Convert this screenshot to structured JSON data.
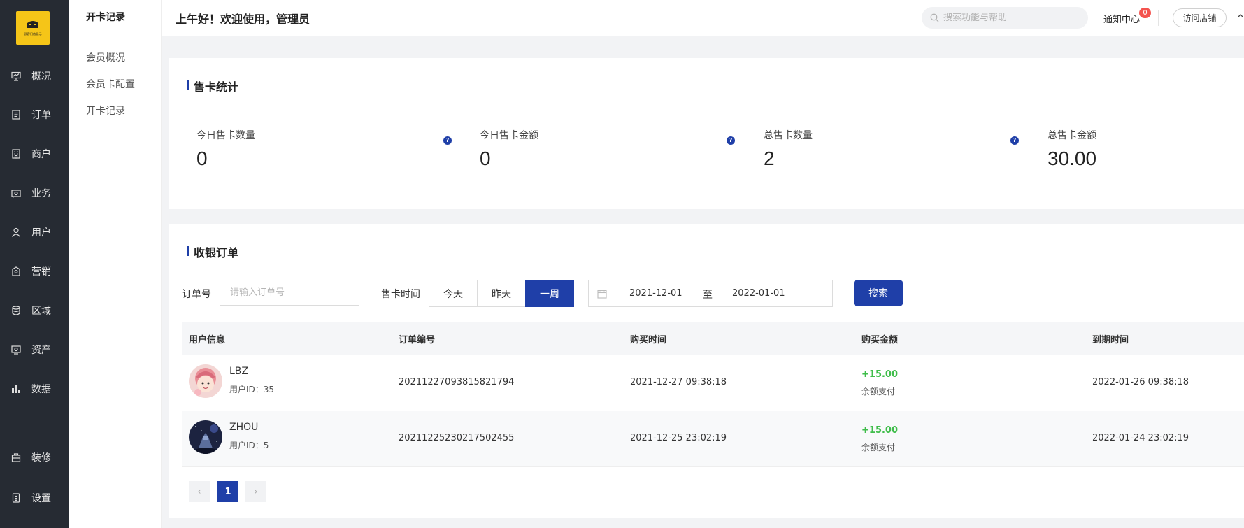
{
  "sidebar": {
    "logo_text": "顾客门店展示",
    "items": [
      {
        "label": "概况",
        "icon": "chart-icon"
      },
      {
        "label": "订单",
        "icon": "document-icon"
      },
      {
        "label": "商户",
        "icon": "building-icon"
      },
      {
        "label": "业务",
        "icon": "briefcase-icon"
      },
      {
        "label": "用户",
        "icon": "user-icon"
      },
      {
        "label": "营销",
        "icon": "marketing-icon"
      },
      {
        "label": "区域",
        "icon": "database-icon"
      },
      {
        "label": "资产",
        "icon": "asset-icon"
      },
      {
        "label": "数据",
        "icon": "bar-chart-icon"
      },
      {
        "label": "装修",
        "icon": "decoration-icon"
      },
      {
        "label": "设置",
        "icon": "settings-icon"
      }
    ]
  },
  "subnav": {
    "title": "开卡记录",
    "items": [
      "会员概况",
      "会员卡配置",
      "开卡记录"
    ]
  },
  "header": {
    "greeting": "上午好！欢迎使用，管理员",
    "search_placeholder": "搜索功能与帮助",
    "notice_label": "通知中心",
    "notice_count": "0",
    "visit_label": "访问店铺"
  },
  "stats": {
    "title": "售卡统计",
    "items": [
      {
        "label": "今日售卡数量",
        "value": "0"
      },
      {
        "label": "今日售卡金额",
        "value": "0"
      },
      {
        "label": "总售卡数量",
        "value": "2"
      },
      {
        "label": "总售卡金额",
        "value": "30.00"
      }
    ],
    "help_glyph": "?"
  },
  "orders": {
    "title": "收银订单",
    "filter": {
      "order_label": "订单号",
      "order_placeholder": "请输入订单号",
      "time_label": "售卡时间",
      "segments": [
        "今天",
        "昨天",
        "一周"
      ],
      "active_segment": "一周",
      "date_start": "2021-12-01",
      "date_sep": "至",
      "date_end": "2022-01-01",
      "search_label": "搜索"
    },
    "columns": [
      "用户信息",
      "订单编号",
      "购买时间",
      "购买金额",
      "到期时间"
    ],
    "rows": [
      {
        "name": "LBZ",
        "uid": "用户ID：35",
        "order_no": "20211227093815821794",
        "buy_time": "2021-12-27 09:38:18",
        "amount": "+15.00",
        "pay_type": "余额支付",
        "expire": "2022-01-26 09:38:18"
      },
      {
        "name": "ZHOU",
        "uid": "用户ID：5",
        "order_no": "20211225230217502455",
        "buy_time": "2021-12-25 23:02:19",
        "amount": "+15.00",
        "pay_type": "余额支付",
        "expire": "2022-01-24 23:02:19"
      }
    ],
    "pagination": {
      "prev": "‹",
      "current": "1",
      "next": "›"
    }
  },
  "colors": {
    "sidebar": "#262b33",
    "accent": "#1f3fa8",
    "amount_green": "#3fbd4a",
    "logo": "#f5c518",
    "badge": "#f4534e"
  }
}
